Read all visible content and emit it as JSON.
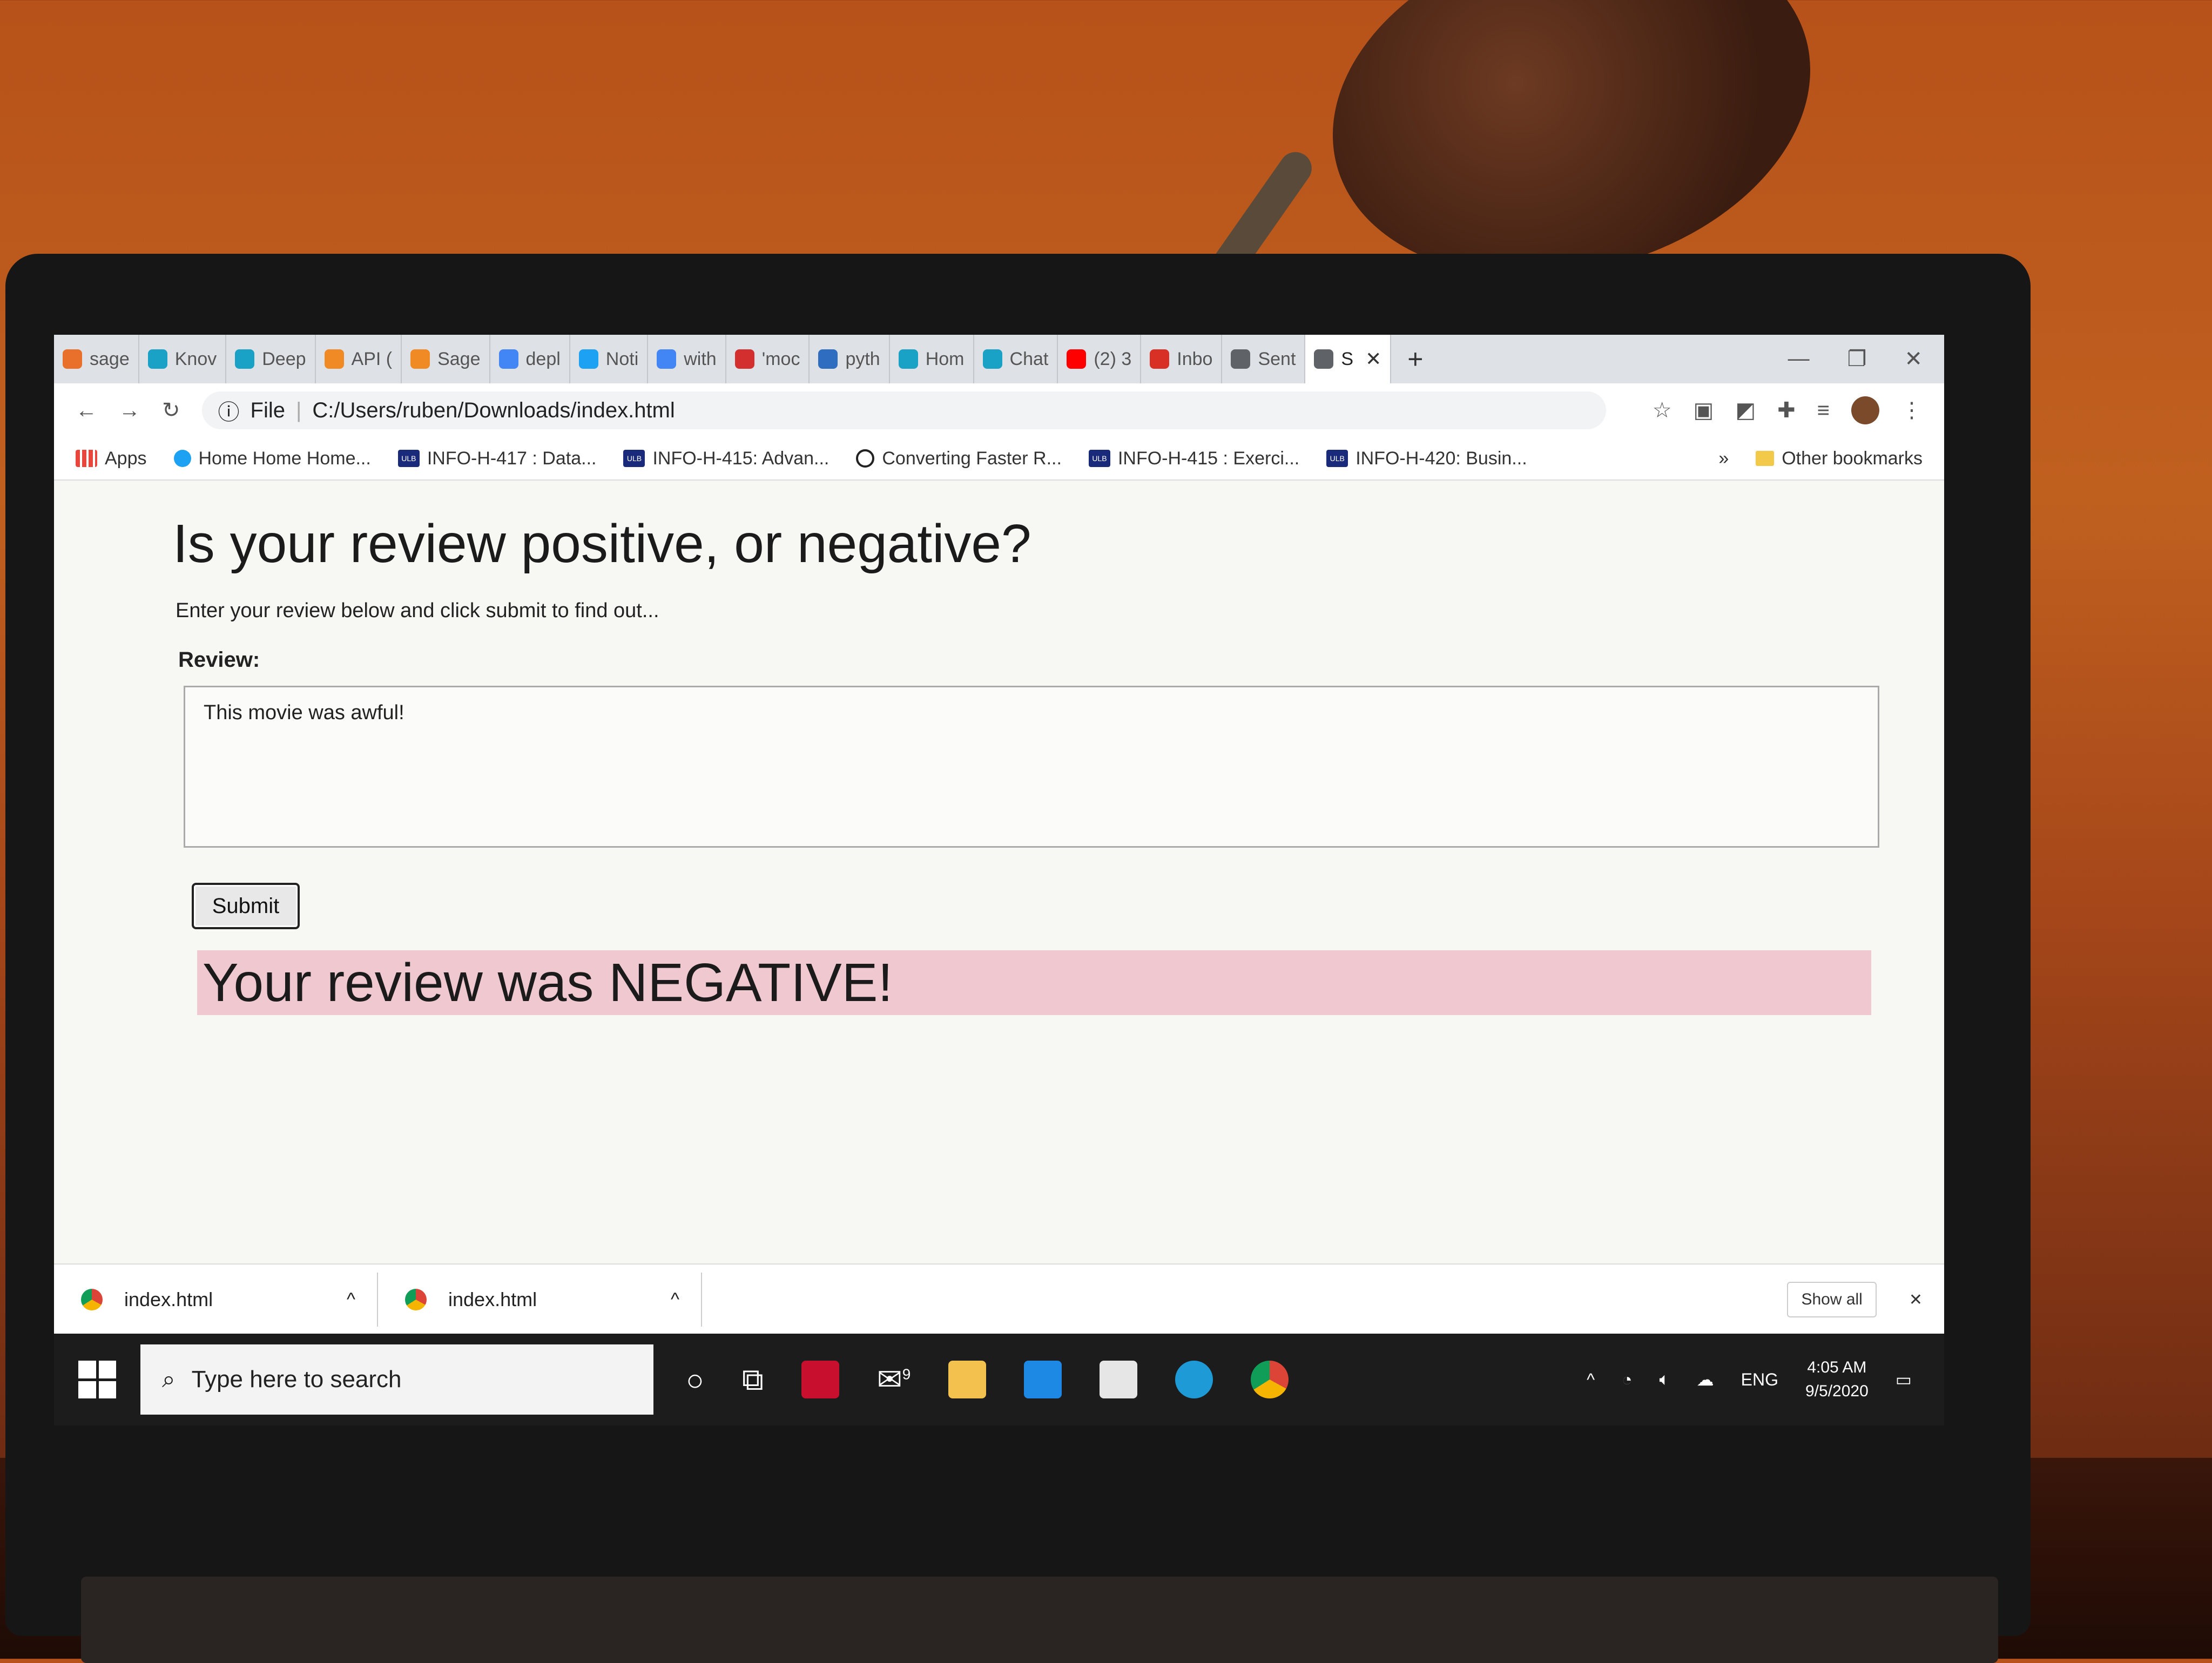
{
  "browser": {
    "tabs": [
      {
        "label": "sage",
        "color": "#e8702a"
      },
      {
        "label": "Knov",
        "color": "#19a1c6"
      },
      {
        "label": "Deep",
        "color": "#19a1c6"
      },
      {
        "label": "API (",
        "color": "#f08a24"
      },
      {
        "label": "Sage",
        "color": "#f08a24"
      },
      {
        "label": "depl",
        "color": "#4285f4"
      },
      {
        "label": "Noti",
        "color": "#1da1f2"
      },
      {
        "label": "with",
        "color": "#4285f4"
      },
      {
        "label": "'moc",
        "color": "#d32f2f"
      },
      {
        "label": "pyth",
        "color": "#2f6dc1"
      },
      {
        "label": "Hom",
        "color": "#19a1c6"
      },
      {
        "label": "Chat",
        "color": "#19a1c6"
      },
      {
        "label": "(2) 3",
        "color": "#ff0000"
      },
      {
        "label": "Inbo",
        "color": "#d93025"
      },
      {
        "label": "Sent",
        "color": "#5f6368"
      },
      {
        "label": "S",
        "color": "#5f6368"
      }
    ],
    "new_tab": "+",
    "address_scheme": "File",
    "address_url": "C:/Users/ruben/Downloads/index.html",
    "bookmarks": [
      {
        "label": "Apps",
        "icon": "apps-grid-icon"
      },
      {
        "label": "Home Home Home...",
        "icon": "twitter-icon"
      },
      {
        "label": "INFO-H-417 : Data...",
        "icon": "ulb-icon"
      },
      {
        "label": "INFO-H-415: Advan...",
        "icon": "ulb-icon"
      },
      {
        "label": "Converting Faster R...",
        "icon": "circle-icon"
      },
      {
        "label": "INFO-H-415 : Exerci...",
        "icon": "ulb-icon"
      },
      {
        "label": "INFO-H-420: Busin...",
        "icon": "ulb-icon"
      }
    ],
    "bookmarks_overflow": "»",
    "other_bookmarks": "Other bookmarks"
  },
  "page": {
    "title": "Is your review positive, or negative?",
    "subtitle": "Enter your review below and click submit to find out...",
    "review_label": "Review:",
    "review_value": "This movie was awful!",
    "submit_label": "Submit",
    "result_text": "Your review was NEGATIVE!",
    "result_bg": "#efc9cf"
  },
  "downloads": {
    "items": [
      {
        "name": "index.html"
      },
      {
        "name": "index.html"
      }
    ],
    "show_all": "Show all"
  },
  "taskbar": {
    "search_placeholder": "Type here to search",
    "mail_badge": "9",
    "language": "ENG",
    "time": "4:05 AM",
    "date": "9/5/2020"
  }
}
